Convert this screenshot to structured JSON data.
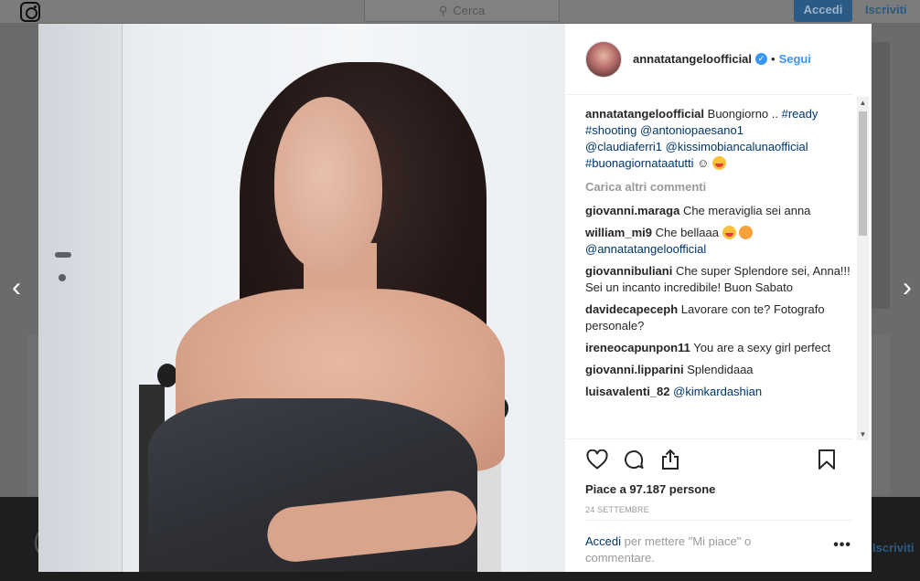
{
  "background": {
    "search_placeholder": "Cerca",
    "login_button": "Accedi",
    "signup_link": "Iscriviti",
    "signup_link_bottom": "Iscriviti"
  },
  "nav": {
    "prev_label": "‹",
    "next_label": "›"
  },
  "post": {
    "username": "annatatangeloofficial",
    "follow_label": "Segui",
    "separator": "•",
    "caption": {
      "user": "annatatangeloofficial",
      "text_before": "Buongiorno ..",
      "tag_ready": "#ready",
      "tag_shooting": "#shooting",
      "mention_antonio": "@antoniopaesano1",
      "mention_claudia": "@claudiaferri1",
      "mention_kissimo": "@kissimobiancalunaofficial",
      "tag_buongiornata": "#buonagiornataatutti"
    },
    "load_more": "Carica altri commenti",
    "comments": [
      {
        "user": "giovanni.maraga",
        "text": "Che meraviglia sei anna"
      },
      {
        "user": "william_mi9",
        "text": "Che bellaaa",
        "mention": "@annatatangeloofficial"
      },
      {
        "user": "giovannibuliani",
        "text": "Che super Splendore sei, Anna!!! Sei un incanto incredibile! Buon Sabato"
      },
      {
        "user": "davidecapeceph",
        "text": "Lavorare con te? Fotografo personale?"
      },
      {
        "user": "ireneocapunpon11",
        "text": "You are a sexy girl perfect"
      },
      {
        "user": "giovanni.lipparini",
        "text": "Splendidaaa"
      },
      {
        "user": "luisavalenti_82",
        "mention": "@kimkardashian"
      }
    ],
    "likes": "Piace a 97.187 persone",
    "date": "24 SETTEMBRE",
    "login_link": "Accedi",
    "login_text": "per mettere \"Mi piace\" o commentare.",
    "more_label": "•••"
  }
}
